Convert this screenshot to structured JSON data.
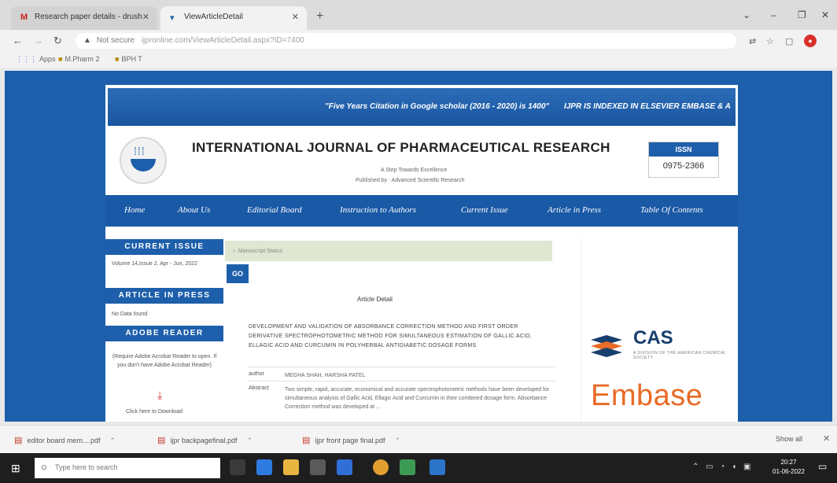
{
  "browser": {
    "tabs": [
      {
        "icon": "gmail-icon",
        "title": "Research paper details - drush"
      },
      {
        "icon": "page-icon",
        "title": "ViewArticleDetail"
      }
    ],
    "address": {
      "security": "Not secure",
      "url": "ijpronline.com/ViewArticleDetail.aspx?ID=7400"
    },
    "bookmarks": [
      {
        "label": "Apps"
      },
      {
        "label": "M.Pharm 2"
      },
      {
        "label": "BPH T"
      }
    ]
  },
  "site": {
    "marquee": [
      "\"Five Years Citation in Google scholar (2016 - 2020) is 1400\"",
      "IJPR IS INDEXED IN ELSEVIER EMBASE & A"
    ],
    "journal_title": "INTERNATIONAL JOURNAL OF PHARMACEUTICAL RESEARCH",
    "tagline": "A Step Towards Excellence",
    "publisher": "Published by : Advanced Scientific Research",
    "issn_label": "ISSN",
    "issn_number": "0975-2366",
    "nav": [
      "Home",
      "About Us",
      "Editorial Board",
      "Instruction to Authors",
      "Current Issue",
      "Article in Press",
      "Table Of Contents"
    ],
    "sidebar": {
      "current_issue_title": "CURRENT ISSUE",
      "current_issue_text": "Volume 14,Issue 2, Apr - Jun, 2022",
      "article_in_press_title": "ARTICLE IN PRESS",
      "article_in_press_text": "No Data found",
      "adobe_title": "ADOBE READER",
      "adobe_text": "(Require Adobe Acrobat Reader to open. If you don't have Adobe Acrobat Reader)",
      "adobe_link": "Click here to Download"
    },
    "search": {
      "placeholder": "Manuscript Status",
      "go_label": "GO"
    },
    "article": {
      "heading": "Article Detail",
      "title": "DEVELOPMENT AND VALIDATION OF ABSORBANCE CORRECTION METHOD AND FIRST ORDER DERIVATIVE SPECTROPHOTOMETRIC METHOD FOR SIMULTANEOUS ESTIMATION OF GALLIC ACID, ELLAGIC ACID AND CURCUMIN IN POLYHERBAL ANTIDIABETIC DOSAGE FORMS",
      "author_label": "author",
      "authors": "MEGHA SHAH, HARSHA PATEL",
      "abstract_label": "Abstract",
      "abstract": "Two simple, rapid, accurate, economical and accurate spectrophotometric methods have been developed for simultaneous analysis of Gallic Acid, Ellagic Acid and Curcumin in their combined dosage form. Absorbance Correction method was developed at ..."
    },
    "partners": {
      "cas_name": "CAS",
      "cas_tagline": "A DIVISION OF THE AMERICAN CHEMICAL SOCIETY",
      "embase_name": "Embase"
    }
  },
  "downloads": {
    "items": [
      {
        "name": "editor board mem....pdf"
      },
      {
        "name": "ijpr backpagefinal.pdf"
      },
      {
        "name": "ijpr front page final.pdf"
      }
    ],
    "show_all": "Show all"
  },
  "taskbar": {
    "search_placeholder": "Type here to search",
    "time": "20:27",
    "date": "01-06-2022"
  },
  "colors": {
    "brand_blue": "#1d5fab",
    "embase_orange": "#e86b26",
    "cas_navy": "#173e6d"
  }
}
